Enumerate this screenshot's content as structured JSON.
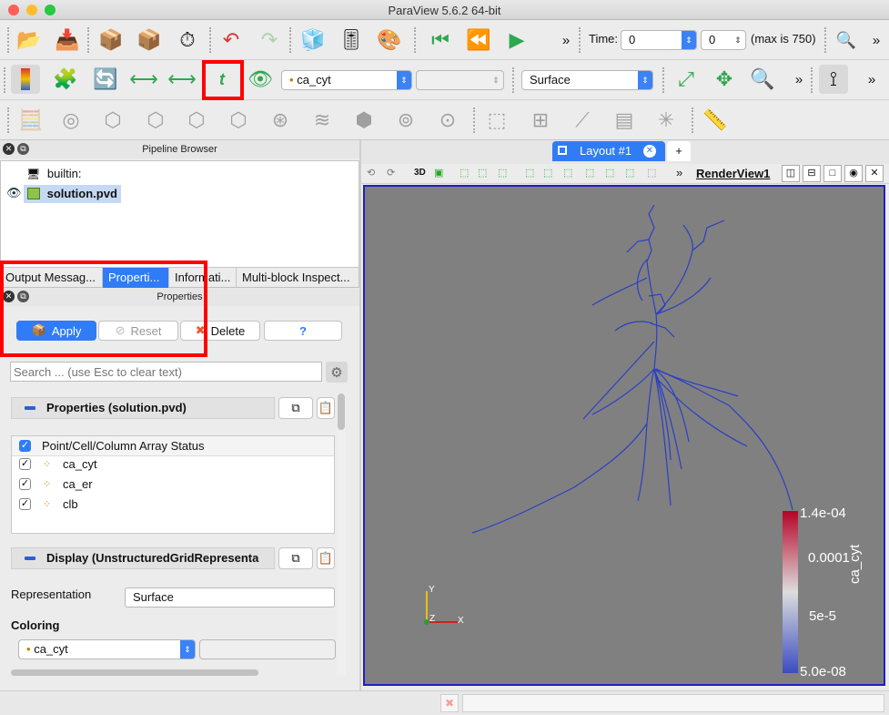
{
  "window": {
    "title": "ParaView 5.6.2 64-bit"
  },
  "toolbar1": {
    "time_label": "Time:",
    "time_value": "0",
    "timestep_value": "0",
    "max_label": "(max is 750)"
  },
  "toolbar2": {
    "array_combo": "ca_cyt",
    "component_combo": "",
    "representation_combo": "Surface"
  },
  "pipeline": {
    "header": "Pipeline Browser",
    "items": [
      {
        "label": "builtin:"
      },
      {
        "label": "solution.pvd"
      }
    ]
  },
  "bottom_tabs": [
    "Output Messag...",
    "Properti...",
    "Informati...",
    "Multi-block Inspect..."
  ],
  "properties": {
    "header": "Properties",
    "apply": "Apply",
    "reset": "Reset",
    "delete": "Delete",
    "help": "?",
    "search_placeholder": "Search ... (use Esc to clear text)",
    "section_properties": "Properties (solution.pvd)",
    "array_header": "Point/Cell/Column Array Status",
    "arrays": [
      "ca_cyt",
      "ca_er",
      "clb"
    ],
    "section_display": "Display (UnstructuredGridRepresenta",
    "representation_label": "Representation",
    "representation_value": "Surface",
    "coloring_label": "Coloring",
    "coloring_value": "ca_cyt"
  },
  "layout": {
    "tab_label": "Layout #1",
    "add_tab": "+",
    "view_3d": "3D",
    "view_name": "RenderView1"
  },
  "colorbar": {
    "title": "ca_cyt",
    "ticks": [
      "1.4e-04",
      "0.0001",
      "5e-5",
      "5.0e-08"
    ],
    "top_color": "#b40426",
    "mid_color": "#dddddd",
    "bottom_color": "#3b4cc0"
  },
  "axes": {
    "x": "X",
    "y": "Y",
    "z": "Z"
  }
}
